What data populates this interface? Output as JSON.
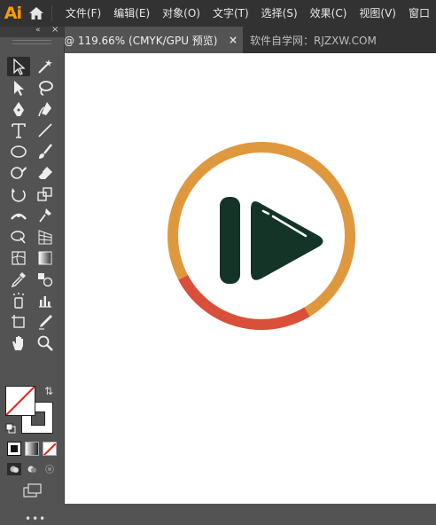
{
  "app": {
    "logo": "Ai"
  },
  "menu": {
    "items": [
      "文件(F)",
      "编辑(E)",
      "对象(O)",
      "文字(T)",
      "选择(S)",
      "效果(C)",
      "视图(V)",
      "窗口"
    ]
  },
  "tabs": {
    "active_title": "@ 119.66% (CMYK/GPU 预览)",
    "close_label": "×",
    "inactive_title": "软件自学网：RJZXW.COM"
  },
  "toolbar": {
    "collapse_label": "«",
    "close_label": "×",
    "more_label": "•••",
    "tools": [
      "selection-tool-icon",
      "magic-wand-tool-icon",
      "direct-selection-tool-icon",
      "lasso-tool-icon",
      "pen-tool-icon",
      "curvature-tool-icon",
      "type-tool-icon",
      "line-segment-tool-icon",
      "ellipse-tool-icon",
      "paintbrush-tool-icon",
      "shaper-tool-icon",
      "eraser-tool-icon",
      "rotate-tool-icon",
      "scale-tool-icon",
      "width-tool-icon",
      "puppet-warp-tool-icon",
      "shape-builder-tool-icon",
      "perspective-grid-tool-icon",
      "mesh-tool-icon",
      "gradient-tool-icon",
      "eyedropper-tool-icon",
      "blend-tool-icon",
      "symbol-sprayer-tool-icon",
      "column-graph-tool-icon",
      "artboard-tool-icon",
      "slice-tool-icon",
      "hand-tool-icon",
      "zoom-tool-icon"
    ],
    "fill_color": "none",
    "stroke_color": "#535353"
  },
  "colors": {
    "ring_orange": "#e0983f",
    "ring_red": "#d94f3a",
    "icon_dark": "#143427",
    "ai_orange": "#ff9a00"
  }
}
